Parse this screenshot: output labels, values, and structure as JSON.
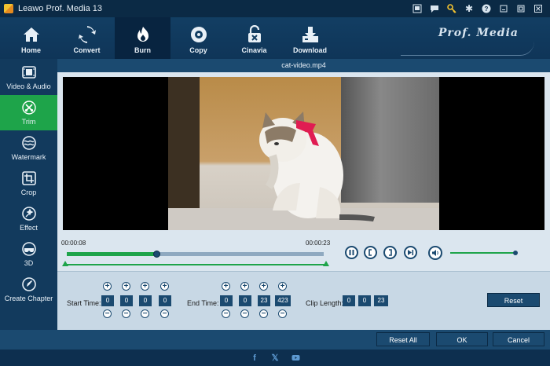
{
  "app": {
    "title": "Leawo Prof. Media 13",
    "brand": "Prof. Media"
  },
  "toolbar": {
    "items": [
      {
        "label": "Home",
        "icon": "home-icon"
      },
      {
        "label": "Convert",
        "icon": "convert-icon"
      },
      {
        "label": "Burn",
        "icon": "burn-icon",
        "active": true
      },
      {
        "label": "Copy",
        "icon": "copy-icon"
      },
      {
        "label": "Cinavia",
        "icon": "cinavia-icon"
      },
      {
        "label": "Download",
        "icon": "download-icon"
      }
    ]
  },
  "window_controls": [
    "cart-icon",
    "chat-icon",
    "key-icon",
    "gear-icon",
    "help-icon",
    "minimize-icon",
    "maximize-icon",
    "close-icon"
  ],
  "sidebar": {
    "items": [
      {
        "label": "Video & Audio",
        "icon": "video-audio-icon"
      },
      {
        "label": "Trim",
        "icon": "trim-icon",
        "active": true
      },
      {
        "label": "Watermark",
        "icon": "watermark-icon"
      },
      {
        "label": "Crop",
        "icon": "crop-icon"
      },
      {
        "label": "Effect",
        "icon": "effect-icon"
      },
      {
        "label": "3D",
        "icon": "3d-icon"
      },
      {
        "label": "Create Chapter",
        "icon": "chapter-icon"
      }
    ]
  },
  "file": {
    "name": "cat-video.mp4"
  },
  "timeline": {
    "current_time": "00:00:08",
    "end_time": "00:00:23",
    "progress_fraction": 0.35,
    "volume_fraction": 0.98
  },
  "trim": {
    "start_label": "Start Time:",
    "start": [
      "0",
      "0",
      "0",
      "0"
    ],
    "end_label": "End Time:",
    "end": [
      "0",
      "0",
      "23",
      "423"
    ],
    "clip_label": "Clip Length:",
    "clip": [
      "0",
      "0",
      "23"
    ],
    "reset_label": "Reset"
  },
  "footer_buttons": {
    "reset_all": "Reset All",
    "ok": "OK",
    "cancel": "Cancel"
  },
  "colors": {
    "accent": "#1ea44a",
    "navy": "#1b4a70",
    "dark": "#0d2f4f"
  }
}
